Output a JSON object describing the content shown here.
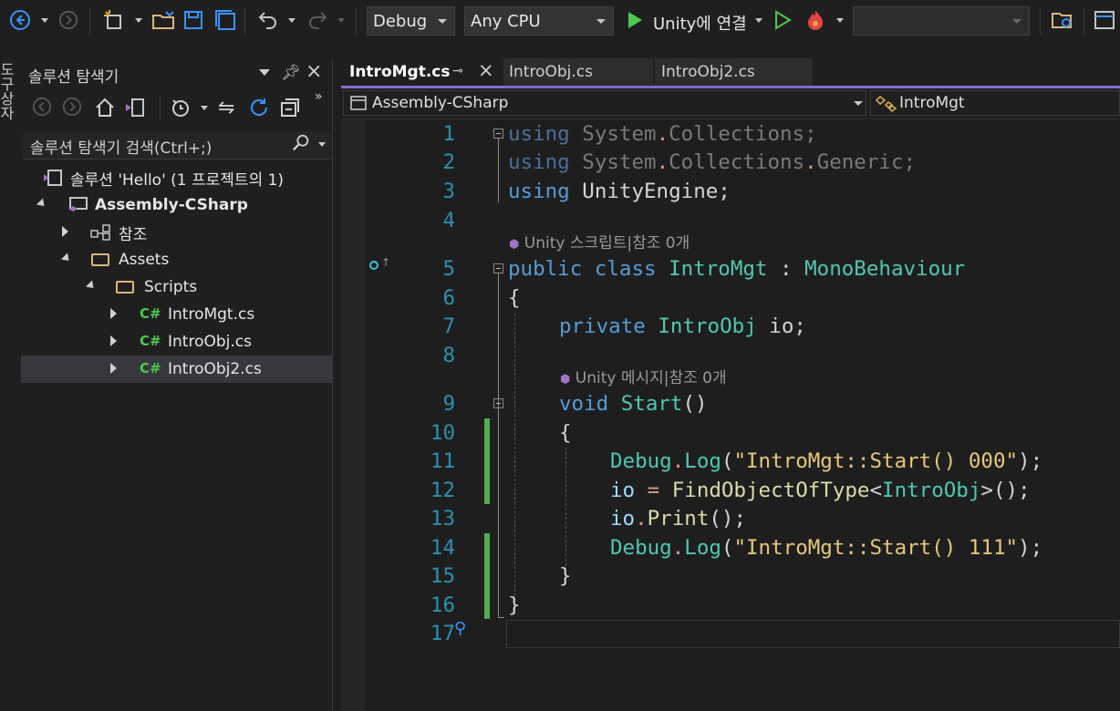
{
  "toolbar": {
    "configuration": "Debug",
    "platform": "Any CPU",
    "run_target": "Unity에 연결",
    "empty_dropdown": ""
  },
  "left_strip": {
    "label": "도구상자"
  },
  "solution_explorer": {
    "title": "솔루션 탐색기",
    "search_placeholder": "솔루션 탐색기 검색(Ctrl+;)",
    "tree": {
      "solution": "솔루션 'Hello' (1 프로젝트의 1)",
      "project": "Assembly-CSharp",
      "references": "참조",
      "assets": "Assets",
      "scripts": "Scripts",
      "files": [
        "IntroMgt.cs",
        "IntroObj.cs",
        "IntroObj2.cs"
      ],
      "cs_badge": "C#"
    }
  },
  "editor": {
    "tabs": [
      {
        "label": "IntroMgt.cs",
        "active": true
      },
      {
        "label": "IntroObj.cs",
        "active": false
      },
      {
        "label": "IntroObj2.cs",
        "active": false
      }
    ],
    "nav_project": "Assembly-CSharp",
    "nav_class": "IntroMgt",
    "line_numbers": [
      "1",
      "2",
      "3",
      "4",
      "5",
      "6",
      "7",
      "8",
      "9",
      "10",
      "11",
      "12",
      "13",
      "14",
      "15",
      "16",
      "17"
    ],
    "codelens_class": "Unity 스크립트|참조 0개",
    "codelens_method": "Unity 메시지|참조 0개",
    "code": {
      "l1_kw": "using",
      "l1_rest_a": "System",
      "l1_dot1": ".",
      "l1_rest_b": "Collections",
      "l1_semi": ";",
      "l2_kw": "using",
      "l2_a": "System",
      "l2_dot1": ".",
      "l2_b": "Collections",
      "l2_dot2": ".",
      "l2_c": "Generic",
      "l2_semi": ";",
      "l3_kw": "using",
      "l3_rest": "UnityEngine;",
      "l5_kw1": "public",
      "l5_kw2": "class",
      "l5_name": "IntroMgt",
      "l5_colon": ":",
      "l5_base": "MonoBehaviour",
      "l6": "{",
      "l7_kw": "private",
      "l7_type": "IntroObj",
      "l7_rest": "io;",
      "l9_kw": "void",
      "l9_name": "Start",
      "l9_rest": "()",
      "l10": "{",
      "l11_cls": "Debug",
      "l11_dot": ".",
      "l11_fn": "Log",
      "l11_open": "(",
      "l11_str": "\"IntroMgt::Start() 000\"",
      "l11_close": ");",
      "l12_a": "io",
      "l12_eq": "=",
      "l12_fn": "FindObjectOfType",
      "l12_lt": "<",
      "l12_type": "IntroObj",
      "l12_rest": ">();",
      "l13_a": "io",
      "l13_dot": ".",
      "l13_fn": "Print",
      "l13_rest": "();",
      "l14_cls": "Debug",
      "l14_dot": ".",
      "l14_fn": "Log",
      "l14_open": "(",
      "l14_str": "\"IntroMgt::Start() 111\"",
      "l14_close": ");",
      "l15": "}",
      "l16": "}"
    }
  }
}
